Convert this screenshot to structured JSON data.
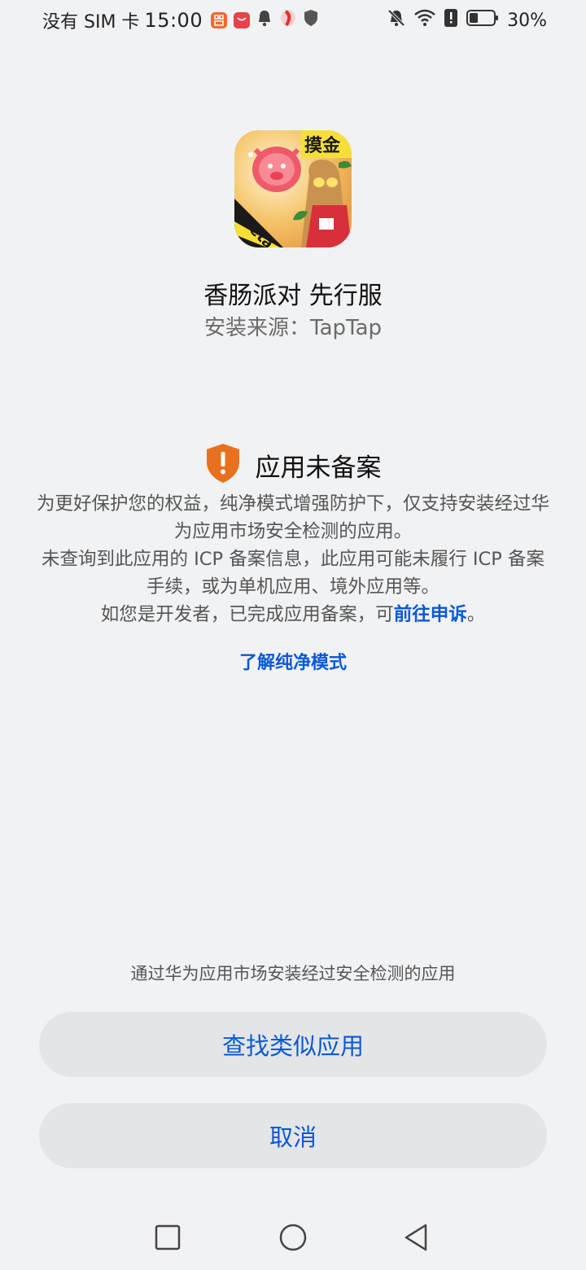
{
  "status_bar": {
    "carrier": "没有 SIM 卡",
    "time": "15:00",
    "battery_percent": "30%"
  },
  "app": {
    "name": "香肠派对 先行服",
    "install_source": "安装来源：TapTap",
    "icon_badge_text": "摸金",
    "icon_corner_text": "Beta"
  },
  "warning": {
    "title": "应用未备案",
    "line1": "为更好保护您的权益，纯净模式增强防护下，仅支持安装经过华为应用市场安全检测的应用。",
    "line2": "未查询到此应用的 ICP 备案信息，此应用可能未履行 ICP 备案手续，或为单机应用、境外应用等。",
    "line3_prefix": "如您是开发者，已完成应用备案，可",
    "line3_link": "前往申诉",
    "line3_suffix": "。",
    "learn_more": "了解纯净模式"
  },
  "footer": {
    "hint": "通过华为应用市场安装经过安全检测的应用",
    "find_similar": "查找类似应用",
    "cancel": "取消"
  },
  "colors": {
    "background": "#f1f2f4",
    "accent_blue": "#0a59d6",
    "shield_orange": "#e8711f",
    "button_bg": "#e4e5e7"
  },
  "icons": [
    "shopee-like-app-icon",
    "huawei-app-icon",
    "notification-bell-icon",
    "app-icon",
    "shield-icon",
    "mute-bell-icon",
    "wifi-icon",
    "alert-icon",
    "battery-icon",
    "warning-shield-icon",
    "square-nav-icon",
    "circle-nav-icon",
    "triangle-back-nav-icon"
  ]
}
